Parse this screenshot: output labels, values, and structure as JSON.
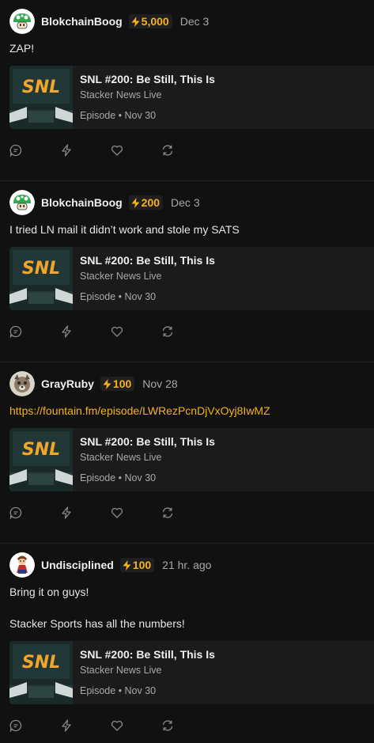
{
  "colors": {
    "zap": "#f7b218",
    "muted": "#a8a8a8",
    "bg": "#111111",
    "card": "#1b1b1b"
  },
  "icons": {
    "zap": "lightning-bolt-icon",
    "reply": "comment-bubble-icon",
    "like": "heart-icon",
    "repost": "repost-arrows-icon"
  },
  "posts": [
    {
      "username": "BlokchainBoog",
      "zap_amount": "5,000",
      "time": "Dec 3",
      "lines": [
        "ZAP!"
      ],
      "card": {
        "title": "SNL #200: Be Still, This Is",
        "show": "Stacker News Live",
        "meta": "Episode • Nov 30",
        "thumb_text": "SNL"
      }
    },
    {
      "username": "BlokchainBoog",
      "zap_amount": "200",
      "time": "Dec 3",
      "lines": [
        "I tried LN mail it didn’t work and stole my SATS"
      ],
      "card": {
        "title": "SNL #200: Be Still, This Is",
        "show": "Stacker News Live",
        "meta": "Episode • Nov 30",
        "thumb_text": "SNL"
      }
    },
    {
      "username": "GrayRuby",
      "zap_amount": "100",
      "time": "Nov 28",
      "lines": [
        "https://fountain.fm/episode/LWRezPcnDjVxOyj8IwMZ"
      ],
      "card": {
        "title": "SNL #200: Be Still, This Is",
        "show": "Stacker News Live",
        "meta": "Episode • Nov 30",
        "thumb_text": "SNL"
      }
    },
    {
      "username": "Undisciplined",
      "zap_amount": "100",
      "time": "21 hr. ago",
      "lines": [
        "Bring it on guys!",
        "Stacker Sports has all the numbers!"
      ],
      "card": {
        "title": "SNL #200: Be Still, This Is",
        "show": "Stacker News Live",
        "meta": "Episode • Nov 30",
        "thumb_text": "SNL"
      }
    }
  ]
}
